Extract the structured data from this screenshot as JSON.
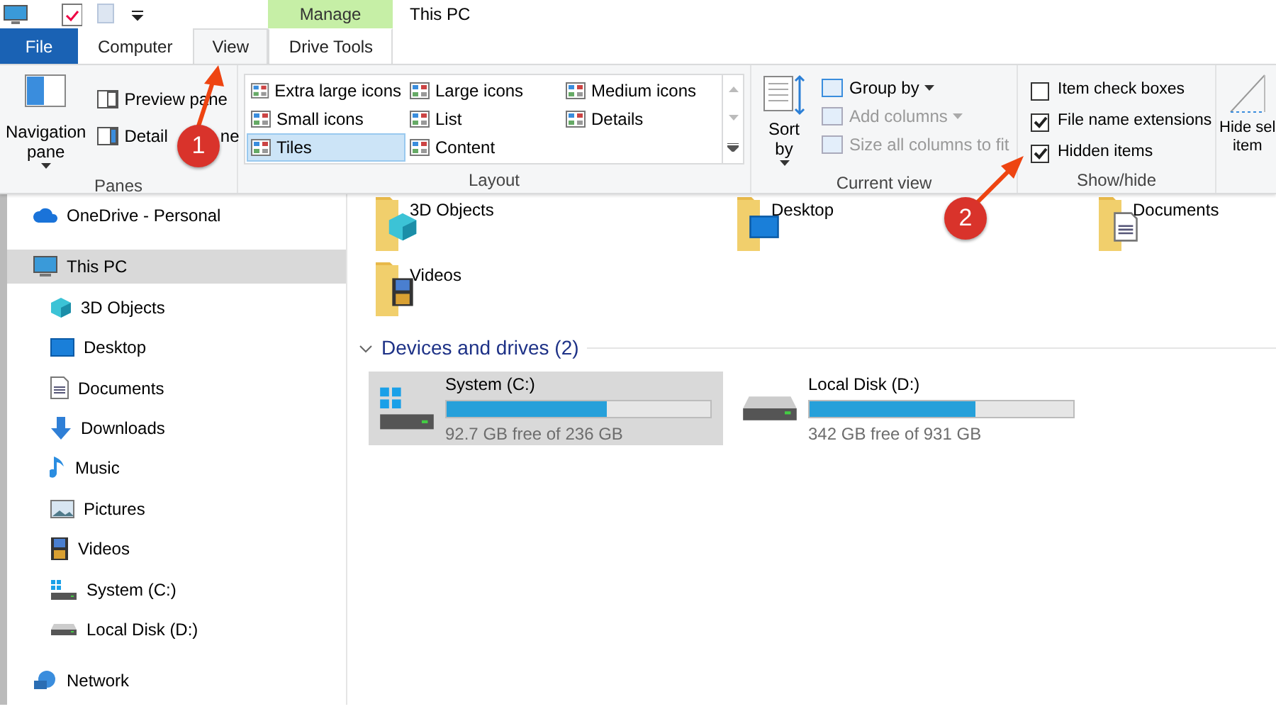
{
  "window": {
    "title": "This PC"
  },
  "contextual_tab": {
    "label": "Manage"
  },
  "tabs": [
    {
      "label": "File",
      "kind": "file",
      "selected": false
    },
    {
      "label": "Computer",
      "kind": "normal",
      "selected": false
    },
    {
      "label": "View",
      "kind": "normal",
      "selected": true
    },
    {
      "label": "Drive Tools",
      "kind": "contextual",
      "selected": false
    }
  ],
  "ribbon": {
    "panes": {
      "label": "Panes",
      "navigation_pane": [
        "Navigation",
        "pane"
      ],
      "items": [
        {
          "label": "Preview pane"
        },
        {
          "label": "Detail",
          "after_badge": "ne"
        }
      ]
    },
    "layout": {
      "label": "Layout",
      "options": [
        {
          "label": "Extra large icons",
          "selected": false
        },
        {
          "label": "Large icons",
          "selected": false
        },
        {
          "label": "Medium icons",
          "selected": false
        },
        {
          "label": "Small icons",
          "selected": false
        },
        {
          "label": "List",
          "selected": false
        },
        {
          "label": "Details",
          "selected": false
        },
        {
          "label": "Tiles",
          "selected": true
        },
        {
          "label": "Content",
          "selected": false
        }
      ]
    },
    "current_view": {
      "label": "Current view",
      "sort_by": [
        "Sort",
        "by"
      ],
      "items": [
        {
          "label": "Group by",
          "disabled": false
        },
        {
          "label": "Add columns",
          "disabled": true
        },
        {
          "label": "Size all columns to fit",
          "disabled": true
        }
      ]
    },
    "show_hide": {
      "label": "Show/hide",
      "checkboxes": [
        {
          "label": "Item check boxes",
          "checked": false
        },
        {
          "label": "File name extensions",
          "checked": true
        },
        {
          "label": "Hidden items",
          "checked": true
        }
      ],
      "hide_selected": [
        "Hide sel",
        "item"
      ]
    }
  },
  "navigation": [
    {
      "label": "OneDrive - Personal",
      "kind": "cloud",
      "selected": false
    },
    {
      "label": "This PC",
      "kind": "pc",
      "selected": true,
      "children": [
        {
          "label": "3D Objects",
          "kind": "cube",
          "selected": false
        },
        {
          "label": "Desktop",
          "kind": "desktop",
          "selected": false
        },
        {
          "label": "Documents",
          "kind": "document",
          "selected": false
        },
        {
          "label": "Downloads",
          "kind": "download",
          "selected": false
        },
        {
          "label": "Music",
          "kind": "music",
          "selected": false
        },
        {
          "label": "Pictures",
          "kind": "pictures",
          "selected": false
        },
        {
          "label": "Videos",
          "kind": "videos",
          "selected": false
        },
        {
          "label": "System (C:)",
          "kind": "system-drive",
          "selected": false
        },
        {
          "label": "Local Disk (D:)",
          "kind": "drive",
          "selected": false
        }
      ]
    },
    {
      "label": "Network",
      "kind": "network",
      "selected": false
    }
  ],
  "folders": [
    {
      "label": "3D Objects",
      "kind": "cube"
    },
    {
      "label": "Desktop",
      "kind": "desktop"
    },
    {
      "label": "Documents",
      "kind": "document"
    },
    {
      "label": "Videos",
      "kind": "videos"
    }
  ],
  "devices": {
    "title": "Devices and drives (2)",
    "expanded": true,
    "drives": [
      {
        "name": "System (C:)",
        "kind": "system-drive",
        "level": 0.61,
        "free": "92.7 GB free of 236 GB",
        "selected": true
      },
      {
        "name": "Local Disk (D:)",
        "kind": "drive",
        "level": 0.63,
        "free": "342 GB free of 931 GB",
        "selected": false
      }
    ]
  },
  "annotations": [
    {
      "label": "1"
    },
    {
      "label": "2"
    }
  ]
}
